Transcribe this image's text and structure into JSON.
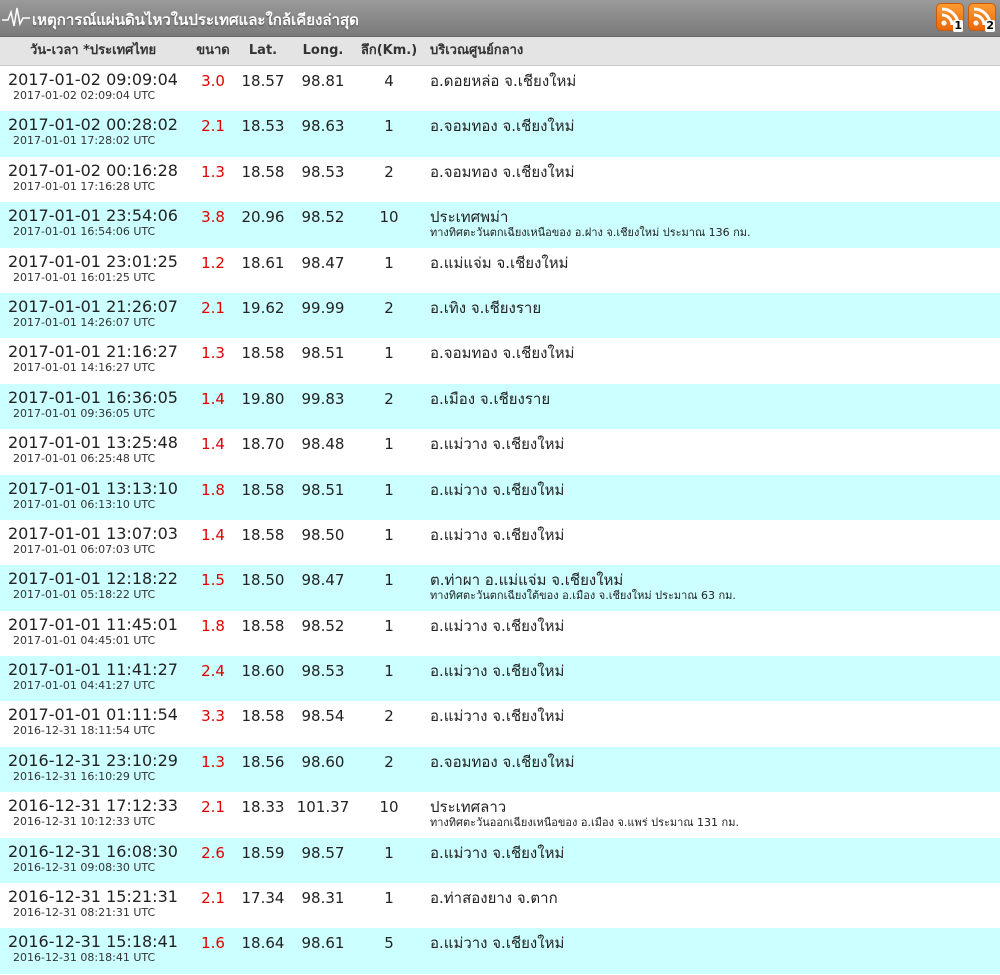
{
  "window": {
    "title": "เหตุการณ์แผ่นดินไหวในประเทศและใกล้เคียงล่าสุด",
    "rss1_label": "1",
    "rss2_label": "2",
    "colors": {
      "header_bar": "#8c8c8c",
      "row_alt": "#ccffff",
      "magnitude": "#e00000",
      "rss": "#f08020"
    }
  },
  "table": {
    "headers": {
      "datetime": "วัน-เวลา *ประเทศไทย",
      "magnitude": "ขนาด",
      "lat": "Lat.",
      "long": "Long.",
      "depth": "ลึก(Km.)",
      "location": "บริเวณศูนย์กลาง"
    },
    "rows": [
      {
        "local": "2017-01-02 09:09:04",
        "utc": "2017-01-02 02:09:04 UTC",
        "mag": "3.0",
        "lat": "18.57",
        "lon": "98.81",
        "depth": "4",
        "loc": "อ.ดอยหล่อ จ.เชียงใหม่",
        "sub": ""
      },
      {
        "local": "2017-01-02 00:28:02",
        "utc": "2017-01-01 17:28:02 UTC",
        "mag": "2.1",
        "lat": "18.53",
        "lon": "98.63",
        "depth": "1",
        "loc": "อ.จอมทอง จ.เชียงใหม่",
        "sub": ""
      },
      {
        "local": "2017-01-02 00:16:28",
        "utc": "2017-01-01 17:16:28 UTC",
        "mag": "1.3",
        "lat": "18.58",
        "lon": "98.53",
        "depth": "2",
        "loc": "อ.จอมทอง จ.เชียงใหม่",
        "sub": ""
      },
      {
        "local": "2017-01-01 23:54:06",
        "utc": "2017-01-01 16:54:06 UTC",
        "mag": "3.8",
        "lat": "20.96",
        "lon": "98.52",
        "depth": "10",
        "loc": "ประเทศพม่า",
        "sub": "ทางทิศตะวันตกเฉียงเหนือของ อ.ฝาง จ.เชียงใหม่ ประมาณ 136 กม."
      },
      {
        "local": "2017-01-01 23:01:25",
        "utc": "2017-01-01 16:01:25 UTC",
        "mag": "1.2",
        "lat": "18.61",
        "lon": "98.47",
        "depth": "1",
        "loc": "อ.แม่แจ่ม จ.เชียงใหม่",
        "sub": ""
      },
      {
        "local": "2017-01-01 21:26:07",
        "utc": "2017-01-01 14:26:07 UTC",
        "mag": "2.1",
        "lat": "19.62",
        "lon": "99.99",
        "depth": "2",
        "loc": "อ.เทิง จ.เชียงราย",
        "sub": ""
      },
      {
        "local": "2017-01-01 21:16:27",
        "utc": "2017-01-01 14:16:27 UTC",
        "mag": "1.3",
        "lat": "18.58",
        "lon": "98.51",
        "depth": "1",
        "loc": "อ.จอมทอง จ.เชียงใหม่",
        "sub": ""
      },
      {
        "local": "2017-01-01 16:36:05",
        "utc": "2017-01-01 09:36:05 UTC",
        "mag": "1.4",
        "lat": "19.80",
        "lon": "99.83",
        "depth": "2",
        "loc": "อ.เมือง จ.เชียงราย",
        "sub": ""
      },
      {
        "local": "2017-01-01 13:25:48",
        "utc": "2017-01-01 06:25:48 UTC",
        "mag": "1.4",
        "lat": "18.70",
        "lon": "98.48",
        "depth": "1",
        "loc": "อ.แม่วาง จ.เชียงใหม่",
        "sub": ""
      },
      {
        "local": "2017-01-01 13:13:10",
        "utc": "2017-01-01 06:13:10 UTC",
        "mag": "1.8",
        "lat": "18.58",
        "lon": "98.51",
        "depth": "1",
        "loc": "อ.แม่วาง จ.เชียงใหม่",
        "sub": ""
      },
      {
        "local": "2017-01-01 13:07:03",
        "utc": "2017-01-01 06:07:03 UTC",
        "mag": "1.4",
        "lat": "18.58",
        "lon": "98.50",
        "depth": "1",
        "loc": "อ.แม่วาง จ.เชียงใหม่",
        "sub": ""
      },
      {
        "local": "2017-01-01 12:18:22",
        "utc": "2017-01-01 05:18:22 UTC",
        "mag": "1.5",
        "lat": "18.50",
        "lon": "98.47",
        "depth": "1",
        "loc": "ต.ท่าผา อ.แม่แจ่ม จ.เชียงใหม่",
        "sub": "ทางทิศตะวันตกเฉียงใต้ของ อ.เมือง จ.เชียงใหม่ ประมาณ 63 กม."
      },
      {
        "local": "2017-01-01 11:45:01",
        "utc": "2017-01-01 04:45:01 UTC",
        "mag": "1.8",
        "lat": "18.58",
        "lon": "98.52",
        "depth": "1",
        "loc": "อ.แม่วาง จ.เชียงใหม่",
        "sub": ""
      },
      {
        "local": "2017-01-01 11:41:27",
        "utc": "2017-01-01 04:41:27 UTC",
        "mag": "2.4",
        "lat": "18.60",
        "lon": "98.53",
        "depth": "1",
        "loc": "อ.แม่วาง จ.เชียงใหม่",
        "sub": ""
      },
      {
        "local": "2017-01-01 01:11:54",
        "utc": "2016-12-31 18:11:54 UTC",
        "mag": "3.3",
        "lat": "18.58",
        "lon": "98.54",
        "depth": "2",
        "loc": "อ.แม่วาง จ.เชียงใหม่",
        "sub": ""
      },
      {
        "local": "2016-12-31 23:10:29",
        "utc": "2016-12-31 16:10:29 UTC",
        "mag": "1.3",
        "lat": "18.56",
        "lon": "98.60",
        "depth": "2",
        "loc": "อ.จอมทอง จ.เชียงใหม่",
        "sub": ""
      },
      {
        "local": "2016-12-31 17:12:33",
        "utc": "2016-12-31 10:12:33 UTC",
        "mag": "2.1",
        "lat": "18.33",
        "lon": "101.37",
        "depth": "10",
        "loc": "ประเทศลาว",
        "sub": "ทางทิศตะวันออกเฉียงเหนือของ อ.เมือง จ.แพร่ ประมาณ 131 กม."
      },
      {
        "local": "2016-12-31 16:08:30",
        "utc": "2016-12-31 09:08:30 UTC",
        "mag": "2.6",
        "lat": "18.59",
        "lon": "98.57",
        "depth": "1",
        "loc": "อ.แม่วาง จ.เชียงใหม่",
        "sub": ""
      },
      {
        "local": "2016-12-31 15:21:31",
        "utc": "2016-12-31 08:21:31 UTC",
        "mag": "2.1",
        "lat": "17.34",
        "lon": "98.31",
        "depth": "1",
        "loc": "อ.ท่าสองยาง จ.ตาก",
        "sub": ""
      },
      {
        "local": "2016-12-31 15:18:41",
        "utc": "2016-12-31 08:18:41 UTC",
        "mag": "1.6",
        "lat": "18.64",
        "lon": "98.61",
        "depth": "5",
        "loc": "อ.แม่วาง จ.เชียงใหม่",
        "sub": ""
      }
    ]
  }
}
